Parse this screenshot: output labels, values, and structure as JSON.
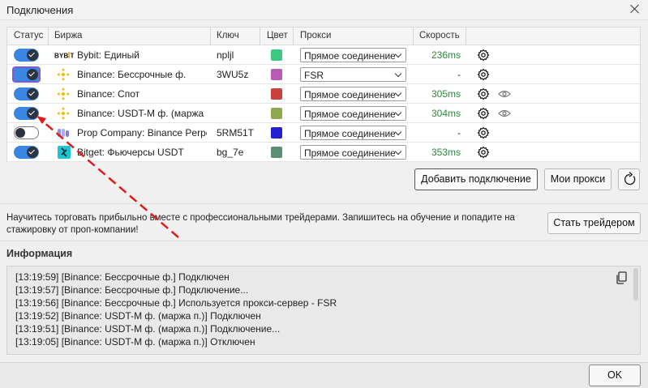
{
  "window": {
    "title": "Подключения"
  },
  "table": {
    "headers": [
      "Статус",
      "Биржа",
      "Ключ",
      "Цвет",
      "Прокси",
      "Скорость"
    ],
    "rows": [
      {
        "on": true,
        "exchange": "Bybit: Единый",
        "logo": "bybit-logo",
        "logo_text": "BYB!T",
        "key": "npljl",
        "color": "#3ec87f",
        "proxy": "Прямое соединение",
        "speed": "236ms",
        "eye": false,
        "focus": false
      },
      {
        "on": true,
        "exchange": "Binance: Бессрочные ф.",
        "logo": "binance-logo",
        "key": "3WU5z",
        "color": "#b85bb3",
        "proxy": "FSR",
        "speed": "-",
        "eye": false,
        "focus": true
      },
      {
        "on": true,
        "exchange": "Binance: Спот",
        "logo": "binance-logo",
        "key": "",
        "color": "#c9413a",
        "proxy": "Прямое соединение",
        "speed": "305ms",
        "eye": true,
        "focus": false
      },
      {
        "on": true,
        "exchange": "Binance: USDT-M ф. (маржа п.)",
        "logo": "binance-logo",
        "key": "",
        "color": "#8fa852",
        "proxy": "Прямое соединение",
        "speed": "304ms",
        "eye": true,
        "focus": false
      },
      {
        "on": false,
        "exchange": "Prop Company: Binance Perpetual",
        "logo": "prop-company-logo",
        "key": "5RM51T",
        "color": "#2222d2",
        "proxy": "Прямое соединение",
        "speed": "-",
        "eye": false,
        "focus": false
      },
      {
        "on": true,
        "exchange": "Bitget: Фьючерсы USDT",
        "logo": "bitget-logo",
        "key": "bg_7e",
        "color": "#5b8e74",
        "proxy": "Прямое соединение",
        "speed": "353ms",
        "eye": false,
        "focus": false
      }
    ]
  },
  "buttons": {
    "add_connection": "Добавить подключение",
    "my_proxies": "Мои прокси",
    "become_trader": "Стать трейдером",
    "ok": "OK"
  },
  "promo": {
    "text": "Научитесь торговать прибыльно вместе с профессиональными трейдерами. Запишитесь на обучение и попадите на стажировку от проп-компании!"
  },
  "info": {
    "title": "Информация",
    "lines": [
      "[13:19:59] [Binance: Бессрочные ф.] Подключен",
      "[13:19:57] [Binance: Бессрочные ф.] Подключение...",
      "[13:19:56] [Binance: Бессрочные ф.] Используется прокси-сервер - FSR",
      "[13:19:52] [Binance: USDT-M ф. (маржа п.)] Подключен",
      "[13:19:51] [Binance: USDT-M ф. (маржа п.)] Подключение...",
      "[13:19:05] [Binance: USDT-M ф. (маржа п.)] Отключен"
    ]
  },
  "colors": {
    "toggle_on": "#3a86e0",
    "speed": "#2c8a3b",
    "annotation_arrow": "#e01b1b",
    "binance": "#f0b90b",
    "bitget": "#1bc6d1"
  }
}
